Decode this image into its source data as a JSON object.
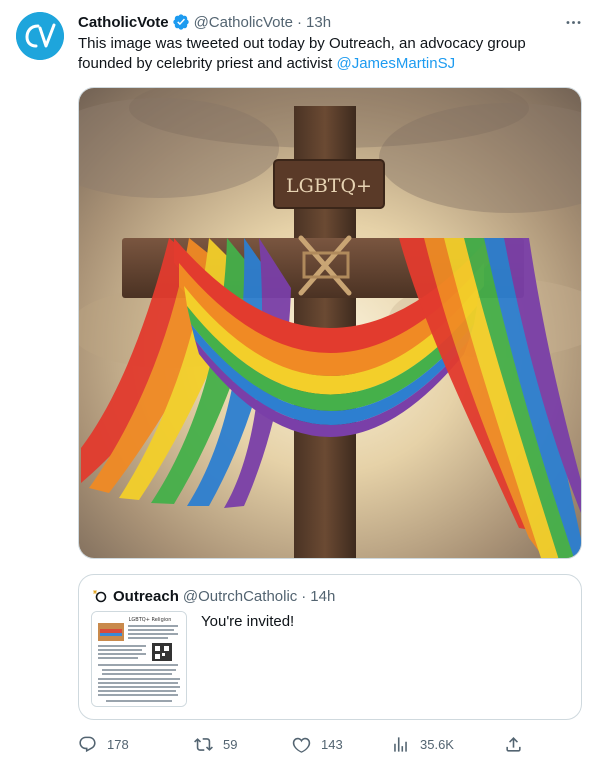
{
  "tweet": {
    "author_name": "CatholicVote",
    "author_handle": "@CatholicVote",
    "separator": "·",
    "time": "13h",
    "text_main": "This image was tweeted out today by Outreach, an advocacy group founded by celebrity priest and activist ",
    "mention": "@JamesMartinSJ",
    "avatar_initials": "CV",
    "icons": {
      "verified": "verified-badge-icon",
      "more": "more-dots-icon"
    },
    "image_sign": "LGBTQ+"
  },
  "quote": {
    "author_name": "Outreach",
    "author_handle": "@OutrchCatholic",
    "separator": "·",
    "time": "14h",
    "text": "You're invited!",
    "thumb_title": "LGBTQ+ Religion"
  },
  "actions": {
    "replies": "178",
    "retweets": "59",
    "likes": "143",
    "views": "35.6K"
  },
  "colors": {
    "accent": "#1d9bf0",
    "secondary_text": "#536471",
    "border": "#cfd9de"
  }
}
